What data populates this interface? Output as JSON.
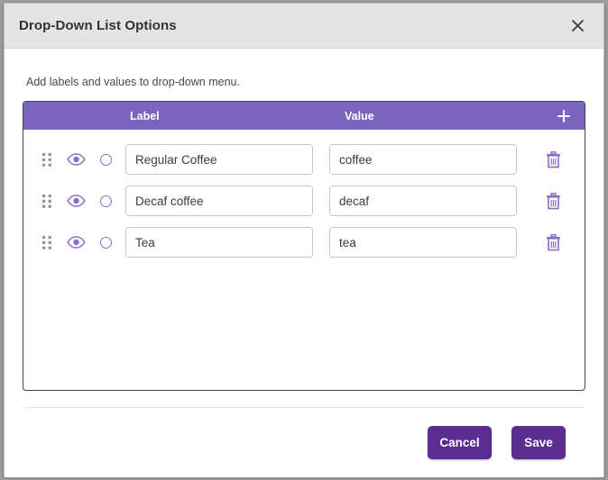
{
  "dialog": {
    "title": "Drop-Down List Options",
    "close_icon": "close-icon",
    "instructions": "Add labels and values to drop-down menu."
  },
  "table": {
    "headers": {
      "label": "Label",
      "value": "Value",
      "add_icon": "plus-icon"
    },
    "row_icons": {
      "drag": "drag-handle-icon",
      "visibility": "eye-icon",
      "select": "radio-button-icon",
      "delete": "trash-icon"
    },
    "rows": [
      {
        "label": "Regular Coffee",
        "value": "coffee"
      },
      {
        "label": "Decaf coffee",
        "value": "decaf"
      },
      {
        "label": "Tea",
        "value": "tea"
      }
    ]
  },
  "footer": {
    "cancel_label": "Cancel",
    "save_label": "Save"
  },
  "colors": {
    "header_purple": "#7a64bf",
    "button_purple": "#5c2d91",
    "icon_purple": "#8a6fc5",
    "titlebar_gray": "#e4e4e4",
    "table_border": "#3f4656",
    "drag_dot": "#8c94ab"
  }
}
